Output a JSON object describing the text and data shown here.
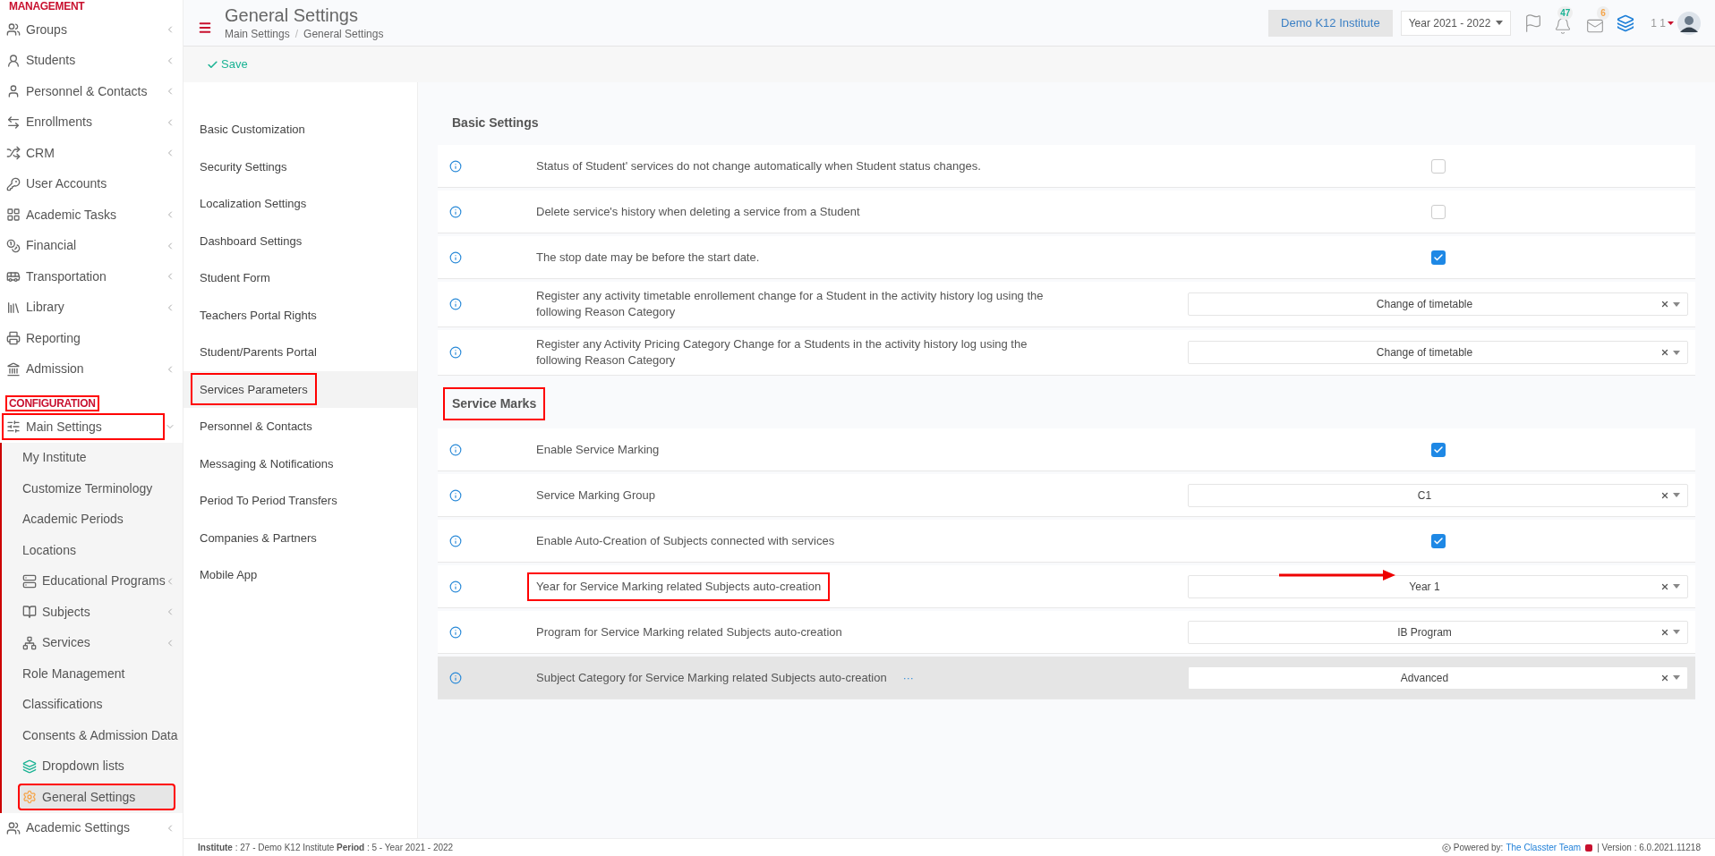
{
  "sidebar": {
    "sections": [
      {
        "title": "MANAGEMENT",
        "annotated": false,
        "items": [
          {
            "label": "Groups",
            "has_children": true,
            "selected": false,
            "annotated": false
          },
          {
            "label": "Students",
            "has_children": true,
            "selected": false,
            "annotated": false
          },
          {
            "label": "Personnel & Contacts",
            "has_children": true,
            "selected": false,
            "annotated": false
          },
          {
            "label": "Enrollments",
            "has_children": true,
            "selected": false,
            "annotated": false
          },
          {
            "label": "CRM",
            "has_children": true,
            "selected": false,
            "annotated": false
          },
          {
            "label": "User Accounts",
            "has_children": false,
            "selected": false,
            "annotated": false
          },
          {
            "label": "Academic Tasks",
            "has_children": true,
            "selected": false,
            "annotated": false
          },
          {
            "label": "Financial",
            "has_children": true,
            "selected": false,
            "annotated": false
          },
          {
            "label": "Transportation",
            "has_children": true,
            "selected": false,
            "annotated": false
          },
          {
            "label": "Library",
            "has_children": true,
            "selected": false,
            "annotated": false
          },
          {
            "label": "Reporting",
            "has_children": false,
            "selected": false,
            "annotated": false
          },
          {
            "label": "Admission",
            "has_children": true,
            "selected": false,
            "annotated": false
          }
        ]
      },
      {
        "title": "CONFIGURATION",
        "annotated": true,
        "items": [
          {
            "label": "Main Settings",
            "has_children": true,
            "expanded": true,
            "selected": false,
            "annotated": true,
            "children": [
              {
                "label": "My Institute",
                "has_children": false,
                "selected": false,
                "annotated": false
              },
              {
                "label": "Customize Terminology",
                "has_children": false,
                "selected": false,
                "annotated": false
              },
              {
                "label": "Academic Periods",
                "has_children": false,
                "selected": false,
                "annotated": false
              },
              {
                "label": "Locations",
                "has_children": false,
                "selected": false,
                "annotated": false
              },
              {
                "label": "Educational Programs",
                "has_children": true,
                "selected": false,
                "annotated": false
              },
              {
                "label": "Subjects",
                "has_children": true,
                "selected": false,
                "annotated": false
              },
              {
                "label": "Services",
                "has_children": true,
                "selected": false,
                "annotated": false
              },
              {
                "label": "Role Management",
                "has_children": false,
                "selected": false,
                "annotated": false
              },
              {
                "label": "Classifications",
                "has_children": false,
                "selected": false,
                "annotated": false
              },
              {
                "label": "Consents & Admission Data",
                "has_children": false,
                "selected": false,
                "annotated": false
              },
              {
                "label": "Dropdown lists",
                "has_children": false,
                "selected": false,
                "annotated": false
              },
              {
                "label": "General Settings",
                "has_children": false,
                "selected": true,
                "annotated": true
              }
            ]
          },
          {
            "label": "Academic Settings",
            "has_children": true,
            "selected": false,
            "annotated": false
          }
        ]
      }
    ]
  },
  "header": {
    "title": "General Settings",
    "breadcrumb": [
      "Main Settings",
      "General Settings"
    ],
    "separator": "/",
    "institute": "Demo K12 Institute",
    "year": "Year 2021 - 2022",
    "notifications": "47",
    "messages": "6",
    "user": "1 1"
  },
  "toolbar": {
    "save": "Save"
  },
  "settings_menu": [
    {
      "label": "Basic Customization",
      "selected": false,
      "annotated": false
    },
    {
      "label": "Security Settings",
      "selected": false,
      "annotated": false
    },
    {
      "label": "Localization Settings",
      "selected": false,
      "annotated": false
    },
    {
      "label": "Dashboard Settings",
      "selected": false,
      "annotated": false
    },
    {
      "label": "Student Form",
      "selected": false,
      "annotated": false
    },
    {
      "label": "Teachers Portal Rights",
      "selected": false,
      "annotated": false
    },
    {
      "label": "Student/Parents Portal",
      "selected": false,
      "annotated": false
    },
    {
      "label": "Services Parameters",
      "selected": true,
      "annotated": true
    },
    {
      "label": "Personnel & Contacts",
      "selected": false,
      "annotated": false
    },
    {
      "label": "Messaging & Notifications",
      "selected": false,
      "annotated": false
    },
    {
      "label": "Period To Period Transfers",
      "selected": false,
      "annotated": false
    },
    {
      "label": "Companies & Partners",
      "selected": false,
      "annotated": false
    },
    {
      "label": "Mobile App",
      "selected": false,
      "annotated": false
    }
  ],
  "groups": [
    {
      "title": "Basic Settings",
      "annotated": false,
      "rows": [
        {
          "kind": "checkbox",
          "label": "Status of Student' services do not change automatically when Student status changes.",
          "checked": false,
          "annotated": false,
          "arrow": false,
          "hovered": false
        },
        {
          "kind": "checkbox",
          "label": "Delete service's history when deleting a service from a Student",
          "checked": false,
          "annotated": false,
          "arrow": false,
          "hovered": false
        },
        {
          "kind": "checkbox",
          "label": "The stop date may be before the start date.",
          "checked": true,
          "annotated": false,
          "arrow": false,
          "hovered": false
        },
        {
          "kind": "select",
          "label": "Register any activity timetable enrollement change for a Student in the activity history log using the following Reason Category",
          "value": "Change of timetable",
          "annotated": false,
          "arrow": false,
          "hovered": false
        },
        {
          "kind": "select",
          "label": "Register any Activity Pricing Category Change for a Students in the activity history log using the following Reason Category",
          "value": "Change of timetable",
          "annotated": false,
          "arrow": false,
          "hovered": false
        }
      ]
    },
    {
      "title": "Service Marks",
      "annotated": true,
      "rows": [
        {
          "kind": "checkbox",
          "label": "Enable Service Marking",
          "checked": true,
          "annotated": false,
          "arrow": false,
          "hovered": false
        },
        {
          "kind": "select",
          "label": "Service Marking Group",
          "value": "C1",
          "annotated": false,
          "arrow": false,
          "hovered": false
        },
        {
          "kind": "checkbox",
          "label": "Enable Auto-Creation of Subjects connected with services",
          "checked": true,
          "annotated": false,
          "arrow": false,
          "hovered": false
        },
        {
          "kind": "select",
          "label": "Year for Service Marking related Subjects auto-creation",
          "value": "Year 1",
          "annotated": true,
          "arrow": true,
          "hovered": false
        },
        {
          "kind": "select",
          "label": "Program for Service Marking related Subjects auto-creation",
          "value": "IB Program",
          "annotated": false,
          "arrow": false,
          "hovered": false
        },
        {
          "kind": "select",
          "label": "Subject Category for Service Marking related Subjects auto-creation",
          "value": "Advanced",
          "annotated": false,
          "arrow": false,
          "hovered": true,
          "more": "···"
        }
      ]
    }
  ],
  "footer": {
    "institute_label": "Institute",
    "institute": " : 27 - Demo K12 Institute ",
    "period_label": "Period",
    "period": " : 5 - Year 2021 - 2022",
    "powered": "Powered by:",
    "team": "The Classter Team",
    "version": "| Version : 6.0.2021.11218"
  }
}
